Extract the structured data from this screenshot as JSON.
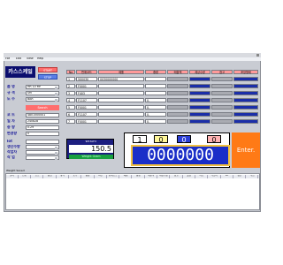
{
  "window": {
    "title": "",
    "menu": [
      "File",
      "Edit",
      "View",
      "Help"
    ]
  },
  "logo": "카스스케일",
  "buttons": {
    "start": "START",
    "stop": "STOP",
    "search": "Search",
    "enter": "Enter."
  },
  "form": {
    "labels": [
      "품 명",
      "규 격",
      "도 수",
      "코 드",
      "일 자",
      "중 량",
      "변경량"
    ],
    "values": [
      "HR 10 MP",
      "SM",
      "BAR",
      "",
      "4801500001",
      "240828",
      "0.29",
      "0"
    ]
  },
  "lot": {
    "labels": [
      "lot",
      "생산수량",
      "작업자",
      "작 업"
    ],
    "values": [
      "",
      "",
      "",
      ""
    ]
  },
  "table": {
    "headers": [
      "No",
      "판매코드",
      "제품",
      "중량",
      "매출액",
      "계상수량",
      "참고",
      "포장형태"
    ],
    "header_colors": [
      "#ff9a9a",
      "#ff9a9a",
      "#ff9a9a",
      "#ff9a9a",
      "#ff9a9a",
      "#ff9a9a",
      "#ff9a9a",
      "#ff9a9a"
    ],
    "rows": [
      [
        "1",
        "500030",
        "0030000000",
        "",
        "",
        "",
        "",
        ""
      ],
      [
        "2",
        "F0001",
        "",
        "",
        "",
        "",
        "",
        ""
      ],
      [
        "3",
        "F403",
        "",
        "",
        "",
        "",
        "",
        ""
      ],
      [
        "4",
        "F1107",
        "",
        "0.",
        "",
        "",
        "",
        ""
      ],
      [
        "5",
        "F0001",
        "",
        "0.",
        "",
        "",
        "",
        ""
      ],
      [
        "6",
        "F1107",
        "",
        "0.",
        "",
        "",
        "",
        ""
      ],
      [
        "7",
        "F0001",
        "",
        "0.",
        "",
        "",
        "",
        ""
      ]
    ]
  },
  "scale": {
    "title": "WEIGHT",
    "value": "150.5",
    "unit_label": "Weight Gram"
  },
  "counter": {
    "digits": [
      "1",
      "0",
      "0",
      "0"
    ],
    "total": "0000000"
  },
  "grid": {
    "caption": "Weight Saved",
    "columns": [
      "일자",
      "번호",
      "코드",
      "품명",
      "규격",
      "도수",
      "중량",
      "시간",
      "판매코드",
      "제품",
      "중량",
      "매출액",
      "계상수량",
      "참고",
      "포장",
      "비고",
      "작업자",
      "lot",
      "생산",
      "작업"
    ]
  },
  "colors": {
    "accent_blue": "#1b2ea8",
    "pink": "#ff6e6e",
    "orange": "#ff7a16",
    "dark_navy": "#0b0e6e"
  }
}
